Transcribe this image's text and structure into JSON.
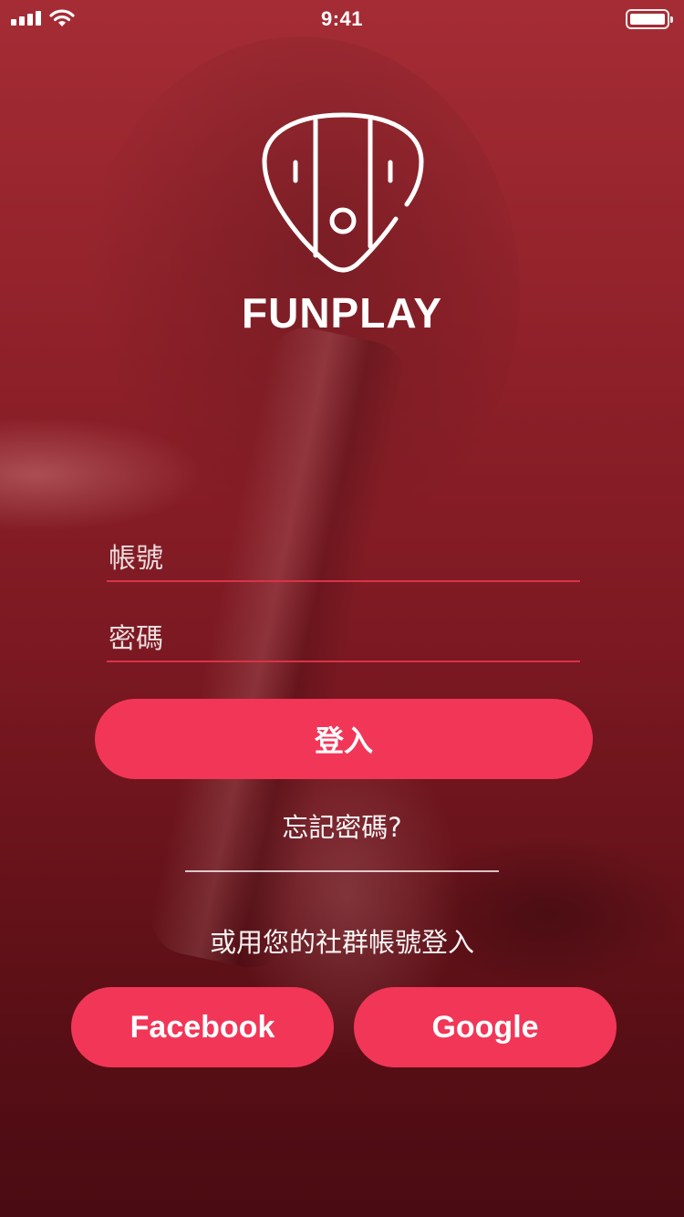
{
  "status_bar": {
    "time": "9:41"
  },
  "brand": {
    "name": "FUNPLAY"
  },
  "login_form": {
    "account_placeholder": "帳號",
    "password_placeholder": "密碼",
    "account_value": "",
    "password_value": "",
    "login_label": "登入",
    "forgot_password_label": "忘記密碼?"
  },
  "social": {
    "prompt": "或用您的社群帳號登入",
    "facebook_label": "Facebook",
    "google_label": "Google"
  },
  "colors": {
    "accent": "#f23657",
    "field_underline": "#d9334a",
    "background_top": "#a52c35",
    "background_bottom": "#4a0b12"
  },
  "icons": {
    "logo": "guitar-pick-icon",
    "signal": "cellular-signal-icon",
    "wifi": "wifi-icon",
    "battery": "battery-icon"
  }
}
